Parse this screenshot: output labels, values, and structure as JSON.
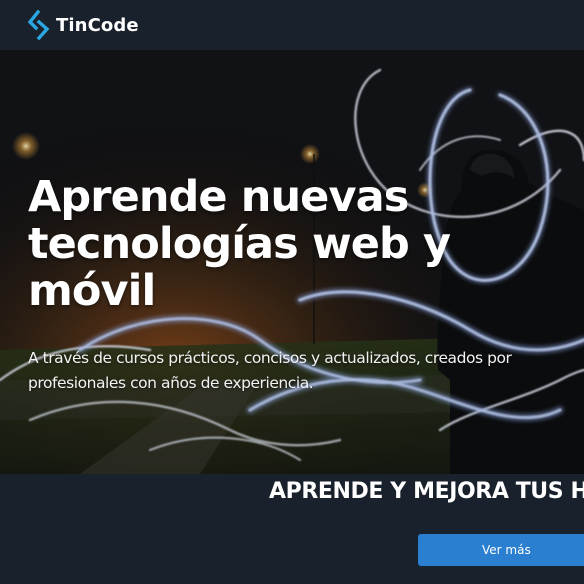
{
  "header": {
    "brand_name": "TinCode",
    "logo_icon": "tincode-logo-icon",
    "accent_color": "#2aa7e3"
  },
  "hero": {
    "title": "Aprende nuevas tecnologías web y móvil",
    "subtitle": "A través de cursos prácticos, concisos y actualizados, creados por profesionales con años de experiencia."
  },
  "tagline": {
    "text": "APRENDE Y MEJORA TUS H"
  },
  "cta": {
    "label": "Ver más",
    "color": "#2a7fd1"
  },
  "colors": {
    "page_background": "#19222c"
  }
}
